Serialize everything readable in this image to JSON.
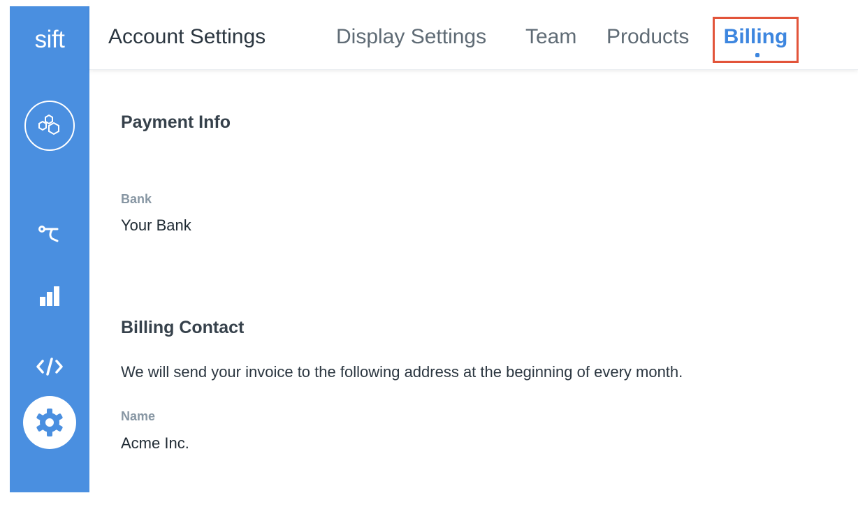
{
  "app": {
    "logo": "sift"
  },
  "sidebar": {
    "items": [
      {
        "icon": "hexagons-icon"
      },
      {
        "icon": "workflow-icon"
      },
      {
        "icon": "bar-chart-icon"
      },
      {
        "icon": "code-icon"
      },
      {
        "icon": "gear-icon",
        "active": true
      }
    ]
  },
  "header": {
    "title": "Account Settings",
    "tabs": [
      {
        "label": "Display Settings"
      },
      {
        "label": "Team"
      },
      {
        "label": "Products"
      },
      {
        "label": "Billing",
        "active": true
      }
    ]
  },
  "payment": {
    "heading": "Payment Info",
    "bank_label": "Bank",
    "bank_value": "Your Bank"
  },
  "billing_contact": {
    "heading": "Billing Contact",
    "description": "We will send your invoice to the following address at the beginning of every month.",
    "name_label": "Name",
    "name_value": "Acme Inc."
  },
  "colors": {
    "sidebar": "#4a8fe0",
    "active_tab": "#3d86df",
    "highlight_box": "#e2543a"
  }
}
